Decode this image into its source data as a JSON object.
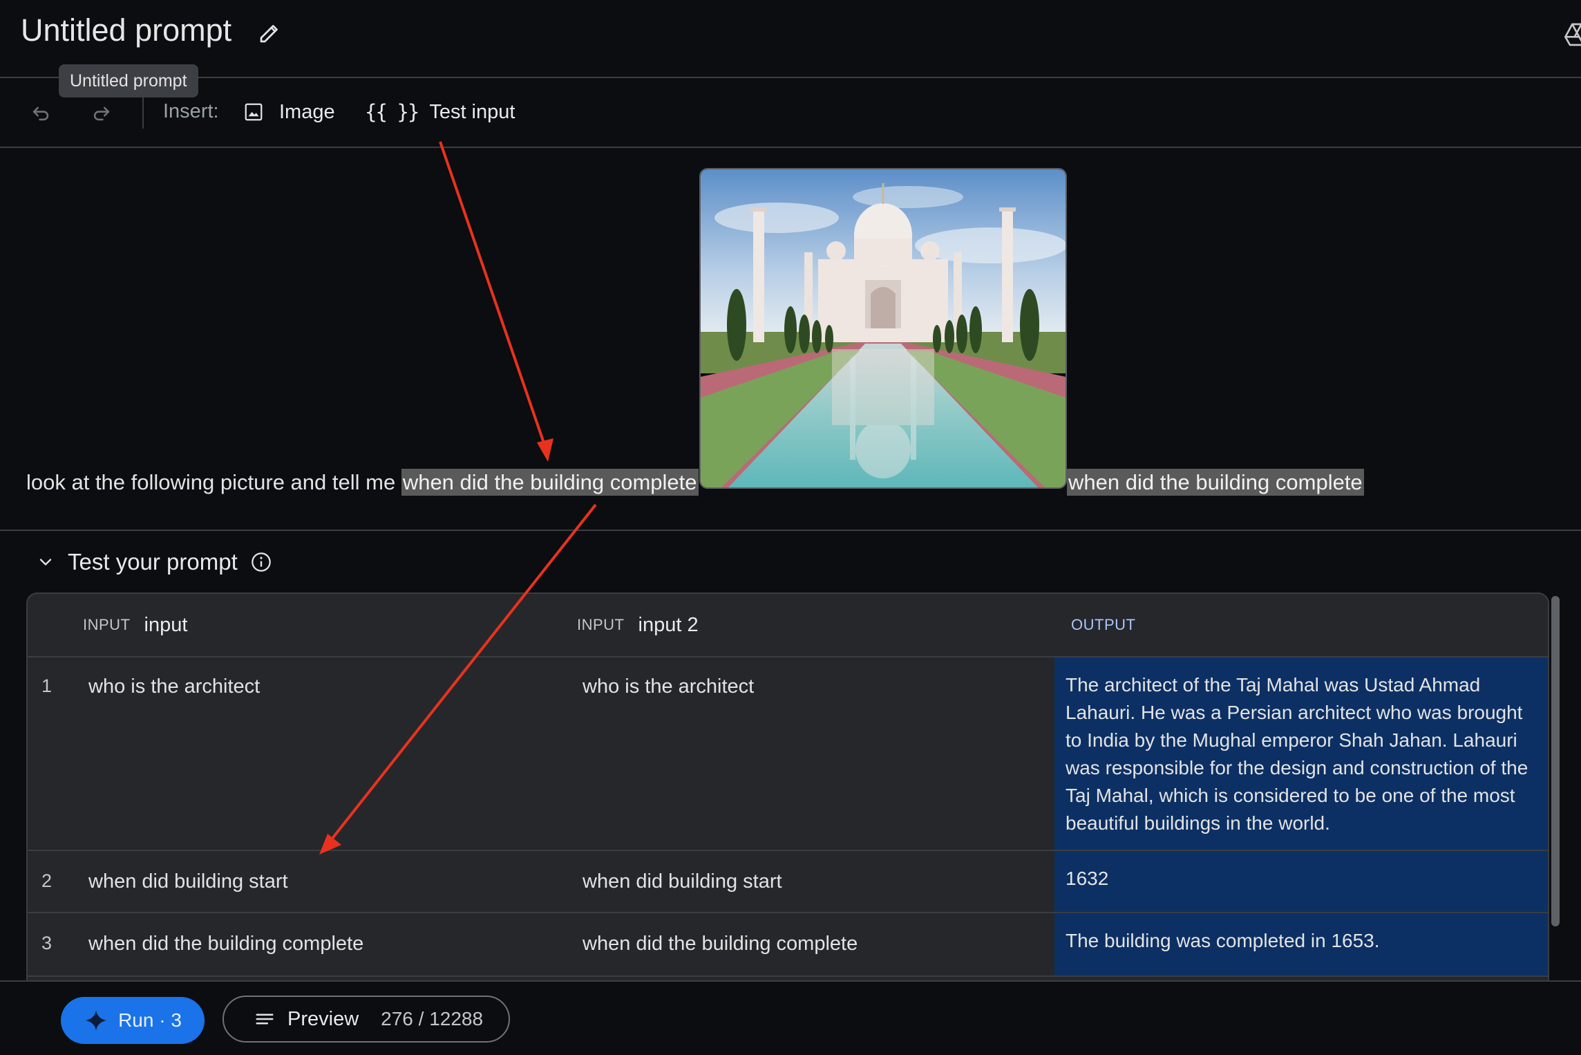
{
  "header": {
    "title": "Untitled prompt",
    "tooltip": "Untitled prompt"
  },
  "toolbar": {
    "insert_label": "Insert:",
    "image_label": "Image",
    "test_input_icon": "{{ }}",
    "test_input_label": "Test input"
  },
  "prompt": {
    "text_before": "look at the following picture and tell me ",
    "variable_1": "when did the building complete",
    "variable_2": "when did the building complete"
  },
  "test_section": {
    "title": "Test your prompt",
    "columns": [
      {
        "kind": "INPUT",
        "name": "input"
      },
      {
        "kind": "INPUT",
        "name": "input 2"
      },
      {
        "kind": "OUTPUT"
      }
    ],
    "rows": [
      {
        "num": "1",
        "input": "who is the architect",
        "input2": "who is the architect",
        "output": "The architect of the Taj Mahal was Ustad Ahmad Lahauri. He was a Persian architect who was brought to India by the Mughal emperor Shah Jahan. Lahauri was responsible for the design and construction of the Taj Mahal, which is considered to be one of the most beautiful buildings in the world."
      },
      {
        "num": "2",
        "input": "when did building start",
        "input2": "when did building start",
        "output": "1632"
      },
      {
        "num": "3",
        "input": "when did the building complete",
        "input2": "when did the building complete",
        "output": "The building was completed in 1653."
      }
    ]
  },
  "footer": {
    "run_label": "Run · 3",
    "preview_label": "Preview",
    "token_count": "276 / 12288"
  },
  "colors": {
    "accent": "#1a73e8",
    "output_bg": "#0c3064",
    "annotation_arrow": "#e8321e"
  },
  "icons": [
    "edit-icon",
    "drive-icon",
    "undo-icon",
    "redo-icon",
    "image-icon",
    "chevron-down-icon",
    "info-icon",
    "sparkle-icon",
    "preview-lines-icon"
  ]
}
